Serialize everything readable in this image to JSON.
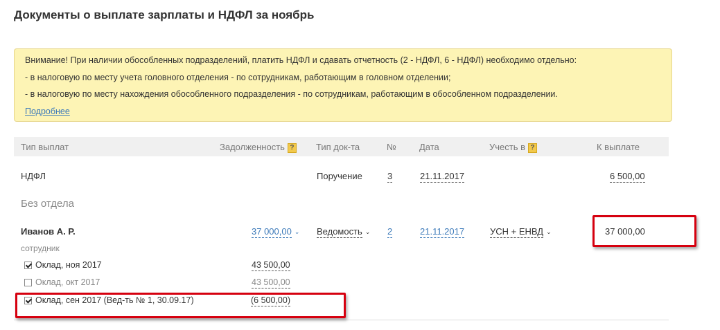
{
  "page": {
    "title": "Документы о выплате зарплаты и НДФЛ за ноябрь"
  },
  "warning": {
    "lines": [
      "Внимание! При наличии обособленных подразделений, платить НДФЛ и сдавать отчетность (2 - НДФЛ, 6 - НДФЛ) необходимо отдельно:",
      "- в налоговую по месту учета головного отделения - по сотрудникам, работающим в головном отделении;",
      "- в налоговую по месту нахождения обособленного подразделения - по сотрудникам, работающим в обособленном подразделении."
    ],
    "more_link": "Подробнее"
  },
  "table": {
    "headers": {
      "type": "Тип выплат",
      "debt": "Задолженность",
      "doc_type": "Тип док-та",
      "num": "№",
      "date": "Дата",
      "account": "Учесть в",
      "payout": "К выплате"
    },
    "help_glyph": "?",
    "ndfl_row": {
      "type": "НДФЛ",
      "doc_type": "Поручение",
      "num": "3",
      "date": "21.11.2017",
      "payout": "6 500,00"
    },
    "group_label": "Без отдела",
    "employee": {
      "name": "Иванов А. Р.",
      "role": "сотрудник",
      "debt": "37 000,00",
      "doc_type": "Ведомость",
      "num": "2",
      "date": "21.11.2017",
      "account": "УСН + ЕНВД",
      "payout": "37 000,00"
    },
    "items": [
      {
        "label": "Оклад, ноя 2017",
        "amount": "43 500,00",
        "checked": true
      },
      {
        "label": "Оклад, окт 2017",
        "amount": "43 500,00",
        "checked": false
      },
      {
        "label": "Оклад, сен 2017 (Вед-ть № 1, 30.09.17)",
        "amount": "(6 500,00)",
        "checked": true
      }
    ]
  },
  "colors": {
    "accent_link": "#3b79b9",
    "warning_bg": "#fdf4b5",
    "highlight_red": "#d6000f"
  }
}
